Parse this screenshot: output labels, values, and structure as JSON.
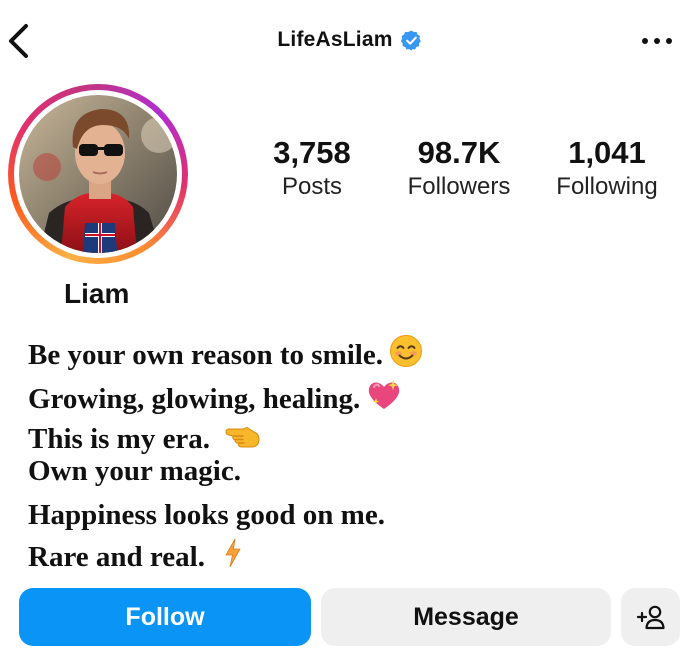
{
  "header": {
    "username": "LifeAsLiam",
    "verified": true,
    "back_icon": "chevron-left-icon",
    "more_icon": "more-horizontal-icon"
  },
  "profile": {
    "display_name": "Liam",
    "avatar_ring_colors": [
      "#fcb045",
      "#fd5c1d",
      "#e1306c",
      "#c13584"
    ]
  },
  "stats": {
    "posts": {
      "value": "3,758",
      "label": "Posts"
    },
    "followers": {
      "value": "98.7K",
      "label": "Followers"
    },
    "following": {
      "value": "1,041",
      "label": "Following"
    }
  },
  "bio": {
    "lines": [
      {
        "text": "Be your own reason to smile.",
        "emoji": "😊"
      },
      {
        "text": "Growing, glowing, healing.",
        "emoji": "💖"
      },
      {
        "text": "This is my era.",
        "emoji": "👈"
      },
      {
        "text": "Own your magic.",
        "emoji": ""
      },
      {
        "text": "Happiness looks good on me.",
        "emoji": ""
      },
      {
        "text": "Rare and real.",
        "emoji": "⚡"
      }
    ]
  },
  "actions": {
    "follow_label": "Follow",
    "message_label": "Message",
    "suggest_icon": "add-person-icon"
  },
  "colors": {
    "follow_button": "#0a95f6",
    "secondary_button": "#efefef",
    "verified_badge": "#3897f0"
  }
}
